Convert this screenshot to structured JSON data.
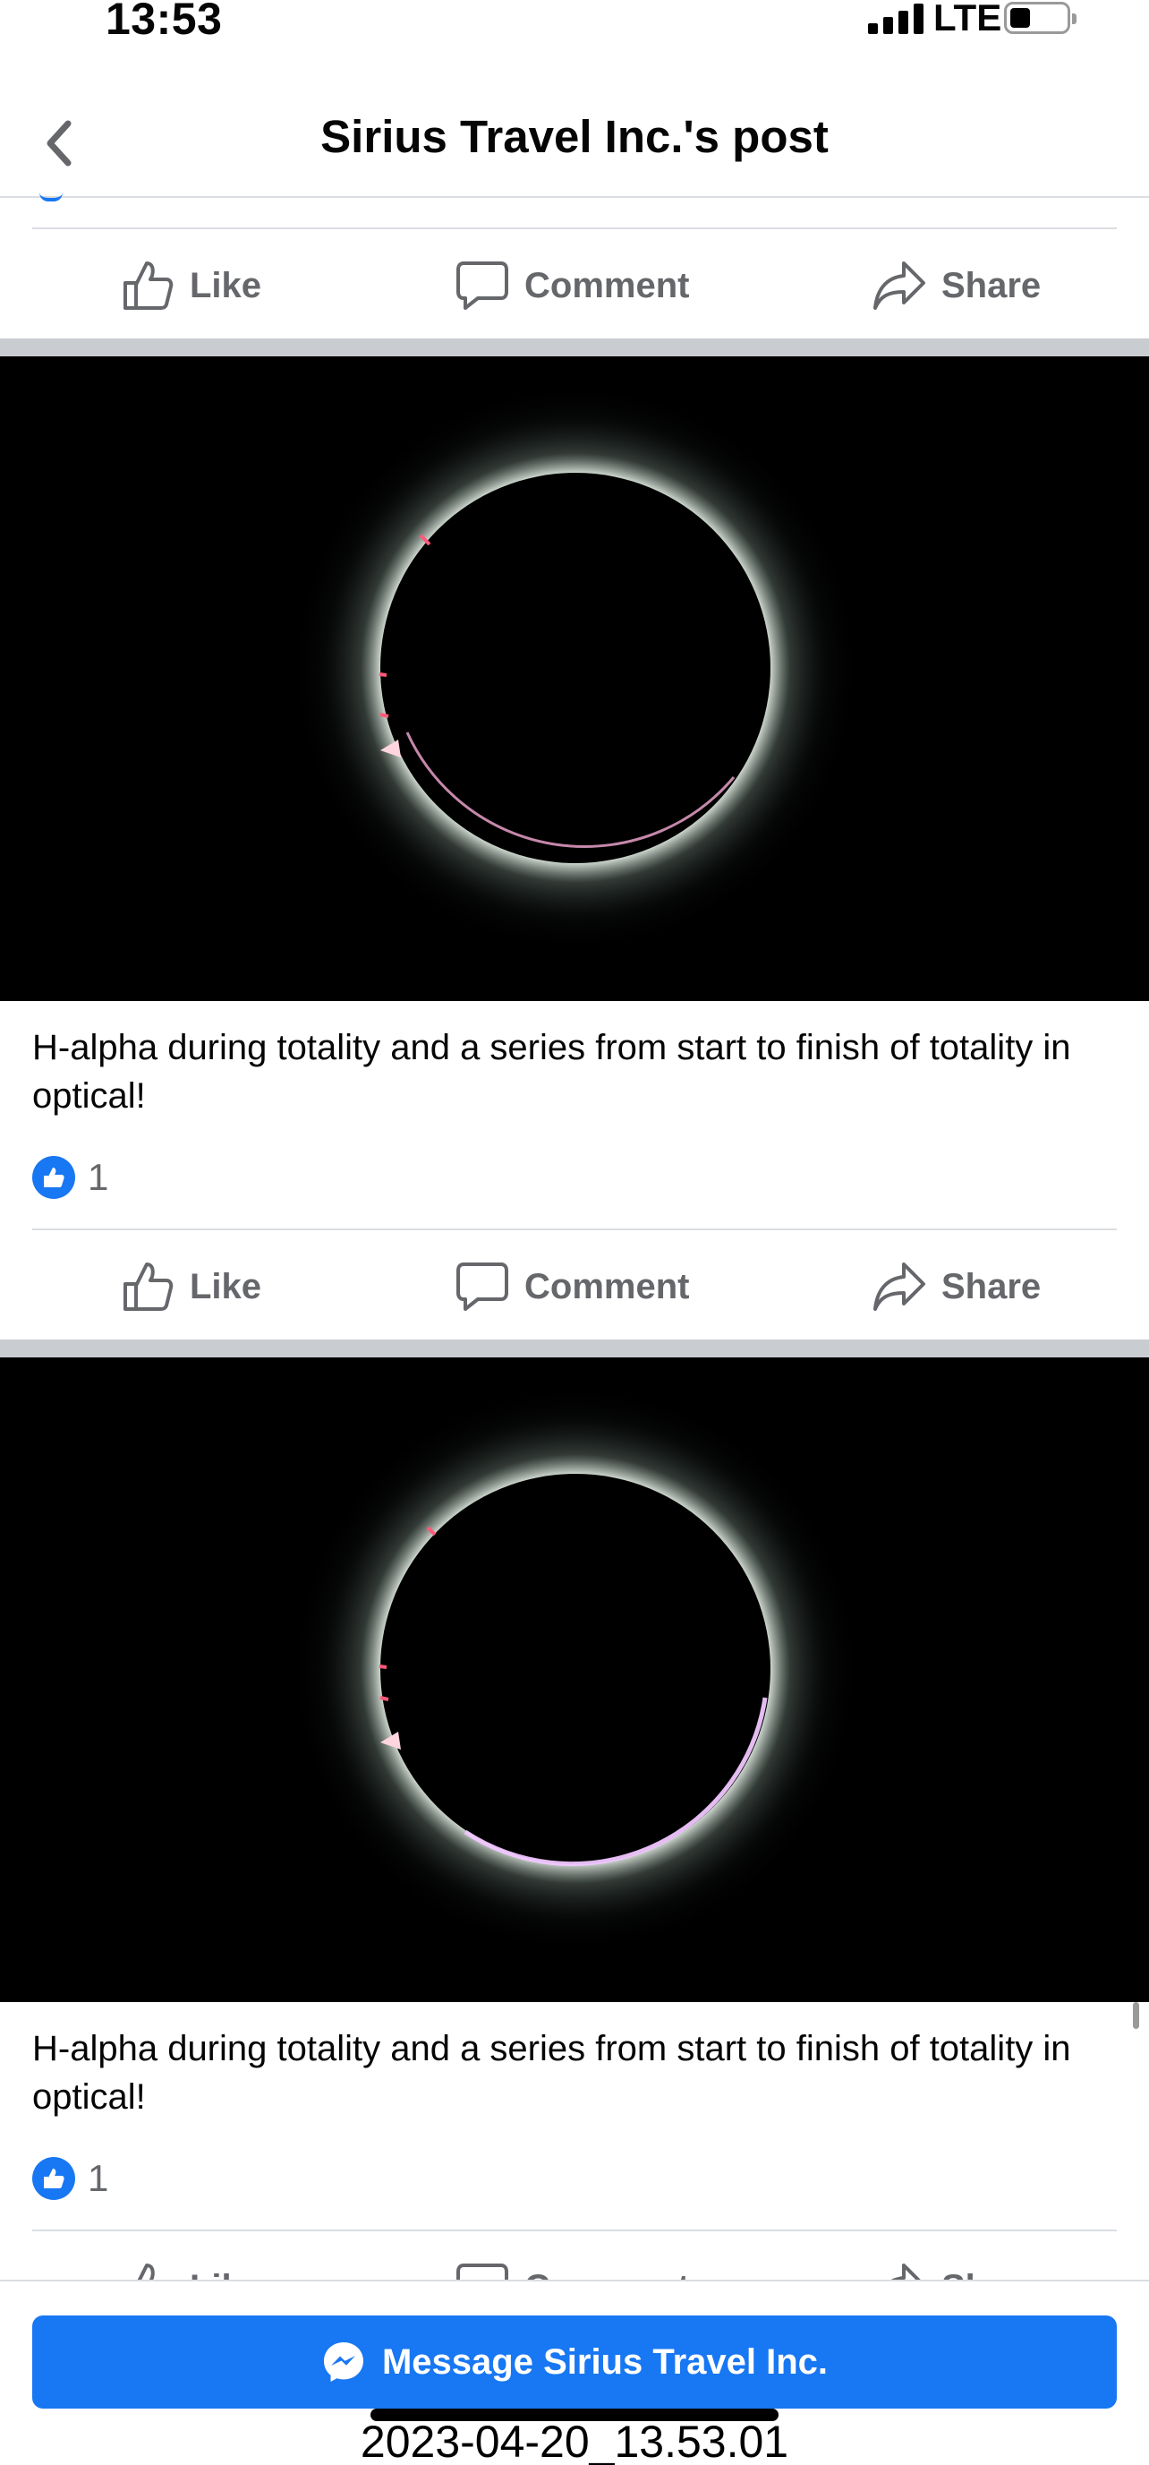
{
  "status_bar": {
    "time": "13:53",
    "network": "LTE",
    "battery_level": 0.2
  },
  "header": {
    "title": "Sirius Travel Inc.'s post",
    "back_icon": "chevron-left-icon"
  },
  "actions": {
    "like": "Like",
    "comment": "Comment",
    "share": "Share"
  },
  "posts": [
    {
      "caption": "H-alpha during totality and a series from start to finish of totality in optical!",
      "reaction_count": "1"
    },
    {
      "caption": "H-alpha during totality and a series from start to finish of totality in optical!",
      "reaction_count": "1"
    }
  ],
  "bottom": {
    "message_button": "Message Sirius Travel Inc.",
    "message_icon": "messenger-icon",
    "timestamp": "2023-04-20_13.53.01"
  },
  "colors": {
    "accent": "#1877f2",
    "secondary_text": "#65676b",
    "separator": "#c9ccd1"
  }
}
